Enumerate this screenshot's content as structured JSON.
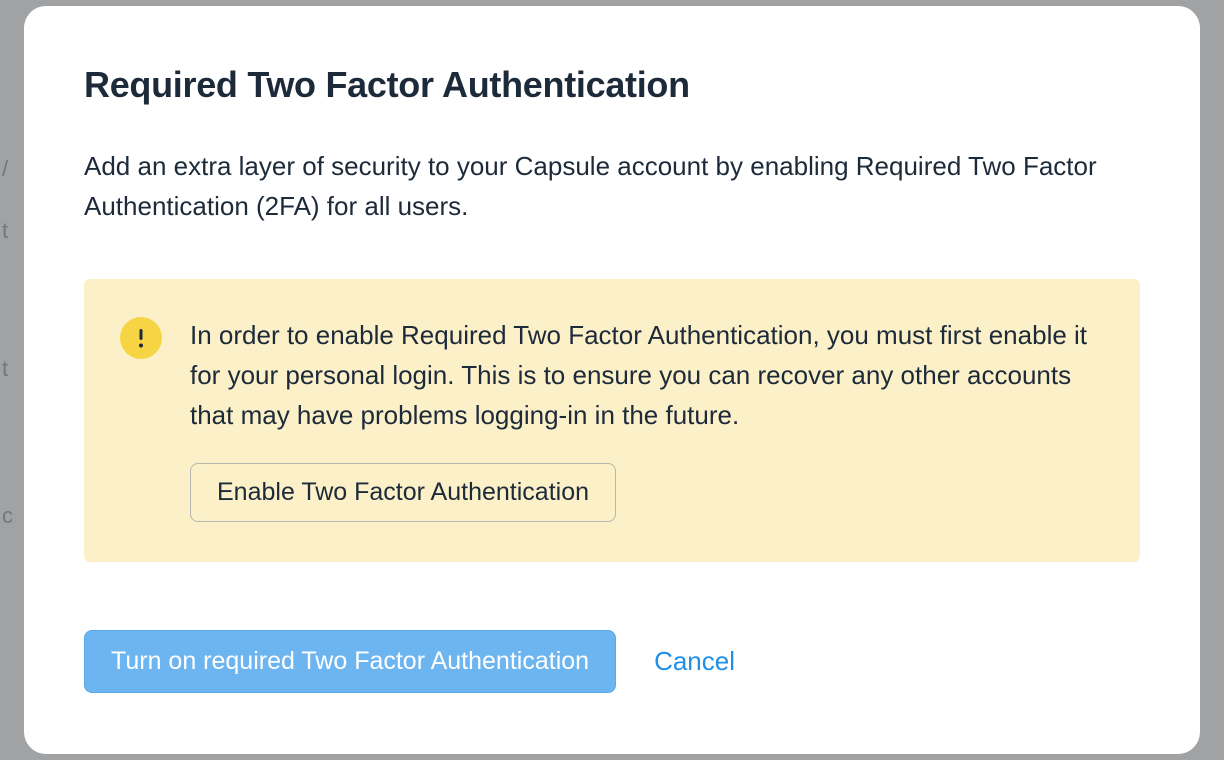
{
  "modal": {
    "title": "Required Two Factor Authentication",
    "description": "Add an extra layer of security to your Capsule account by enabling Required Two Factor Authentication (2FA) for all users.",
    "alert": {
      "text": "In order to enable Required Two Factor Authentication, you must first enable it for your personal login. This is to ensure you can recover any other accounts that may have problems logging-in in the future.",
      "enable_button_label": "Enable Two Factor Authentication"
    },
    "primary_button_label": "Turn on required Two Factor Authentication",
    "cancel_button_label": "Cancel"
  }
}
